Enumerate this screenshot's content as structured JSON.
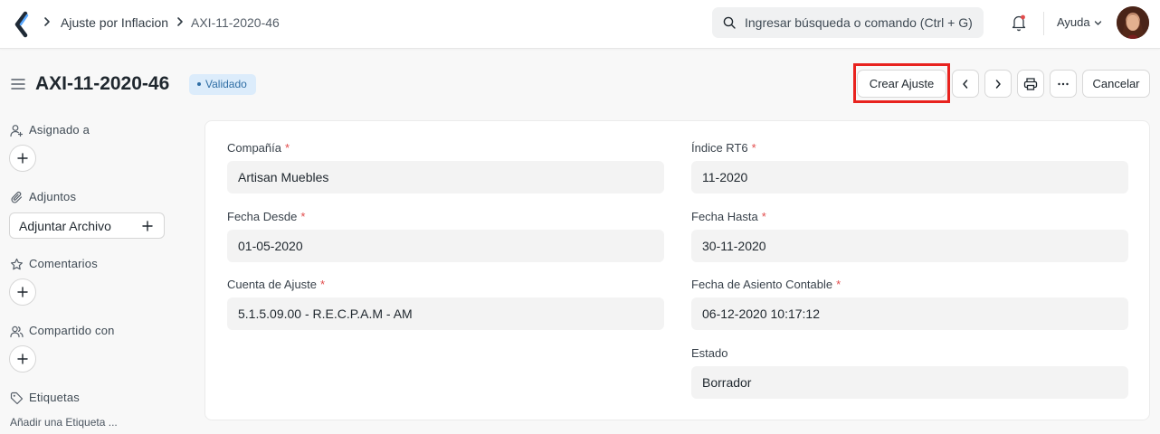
{
  "navbar": {
    "breadcrumbs": [
      "Ajuste por Inflacion",
      "AXI-11-2020-46"
    ],
    "search_placeholder": "Ingresar búsqueda o comando (Ctrl + G)",
    "help_label": "Ayuda"
  },
  "page": {
    "title": "AXI-11-2020-46",
    "status_badge": "Validado"
  },
  "toolbar": {
    "create_adjustment_label": "Crear Ajuste",
    "cancel_label": "Cancelar"
  },
  "sidebar": {
    "assigned_label": "Asignado a",
    "attachments_label": "Adjuntos",
    "attach_file_label": "Adjuntar Archivo",
    "comments_label": "Comentarios",
    "shared_label": "Compartido con",
    "tags_label": "Etiquetas",
    "add_tag_label": "Añadir una Etiqueta ..."
  },
  "form": {
    "company": {
      "label": "Compañía",
      "value": "Artisan Muebles",
      "required": true
    },
    "rt6_index": {
      "label": "Índice RT6",
      "value": "11-2020",
      "required": true
    },
    "date_from": {
      "label": "Fecha Desde",
      "value": "01-05-2020",
      "required": true
    },
    "date_to": {
      "label": "Fecha Hasta",
      "value": "30-11-2020",
      "required": true
    },
    "adjustment_account": {
      "label": "Cuenta de Ajuste",
      "value": "5.1.5.09.00 - R.E.C.P.A.M - AM",
      "required": true
    },
    "posting_date": {
      "label": "Fecha de Asiento Contable",
      "value": "06-12-2020 10:17:12",
      "required": true
    },
    "status": {
      "label": "Estado",
      "value": "Borrador",
      "required": false
    }
  },
  "colors": {
    "badge_bg": "#dcecfb",
    "badge_text": "#2f6ea5",
    "required_star": "#e24c4c",
    "highlight_box": "#e8231f"
  }
}
